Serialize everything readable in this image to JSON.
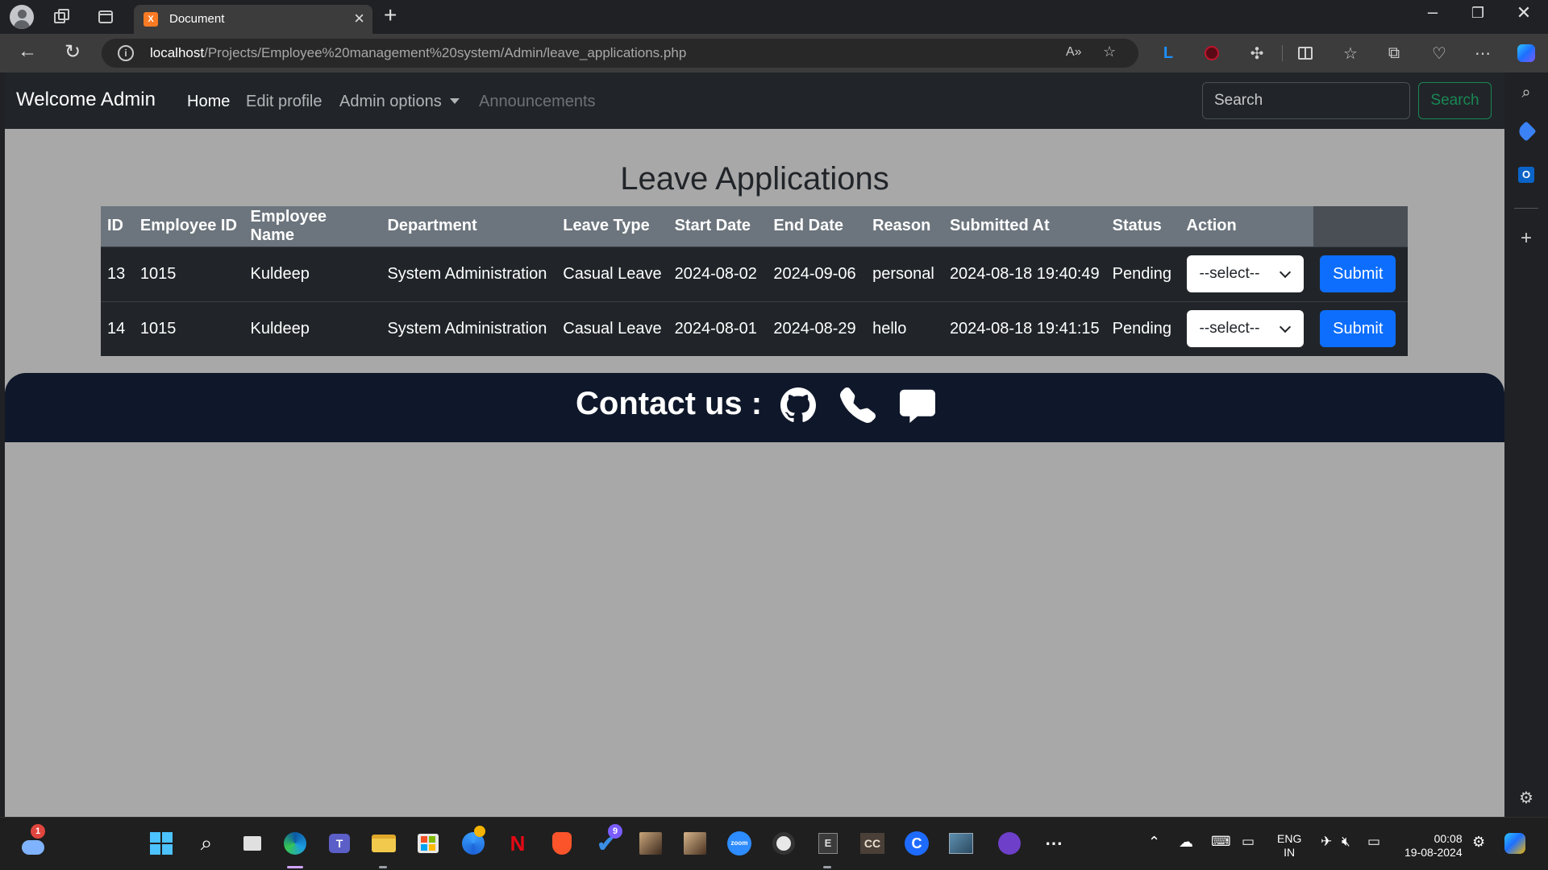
{
  "browser": {
    "tab_title": "Document",
    "tab_favicon": "xampp-icon",
    "url_host": "localhost",
    "url_path": "/Projects/Employee%20management%20system/Admin/leave_applications.php"
  },
  "navbar": {
    "brand": "Welcome Admin",
    "links": [
      "Home",
      "Edit profile",
      "Admin options",
      "Announcements"
    ],
    "search_placeholder": "Search",
    "search_button": "Search"
  },
  "page": {
    "title": "Leave Applications"
  },
  "table": {
    "headers": [
      "ID",
      "Employee ID",
      "Employee Name",
      "Department",
      "Leave Type",
      "Start Date",
      "End Date",
      "Reason",
      "Submitted At",
      "Status",
      "Action"
    ],
    "rows": [
      {
        "id": "13",
        "employee_id": "1015",
        "employee_name": "Kuldeep",
        "department": "System Administration",
        "leave_type": "Casual Leave",
        "start_date": "2024-08-02",
        "end_date": "2024-09-06",
        "reason": "personal",
        "submitted_at": "2024-08-18 19:40:49",
        "status": "Pending",
        "action_select": "--select--",
        "submit": "Submit"
      },
      {
        "id": "14",
        "employee_id": "1015",
        "employee_name": "Kuldeep",
        "department": "System Administration",
        "leave_type": "Casual Leave",
        "start_date": "2024-08-01",
        "end_date": "2024-08-29",
        "reason": "hello",
        "submitted_at": "2024-08-18 19:41:15",
        "status": "Pending",
        "action_select": "--select--",
        "submit": "Submit"
      }
    ]
  },
  "footer": {
    "contact_label": "Contact us :",
    "icons": [
      "github-icon",
      "phone-icon",
      "chat-icon"
    ]
  },
  "taskbar": {
    "weather_badge": "1",
    "todo_badge": "9",
    "zoom_label": "zoom",
    "e_label": "E",
    "cc_label": "CC",
    "c_label": "C",
    "language": "ENG",
    "region": "IN",
    "time": "00:08",
    "date": "19-08-2024"
  },
  "colors": {
    "navbar_bg": "#212529",
    "page_bg": "#a8a8a8",
    "table_header_bg": "#6c757d",
    "submit_btn": "#0d6efd",
    "search_btn_outline": "#198754",
    "footer_bg": "#0f172a"
  }
}
